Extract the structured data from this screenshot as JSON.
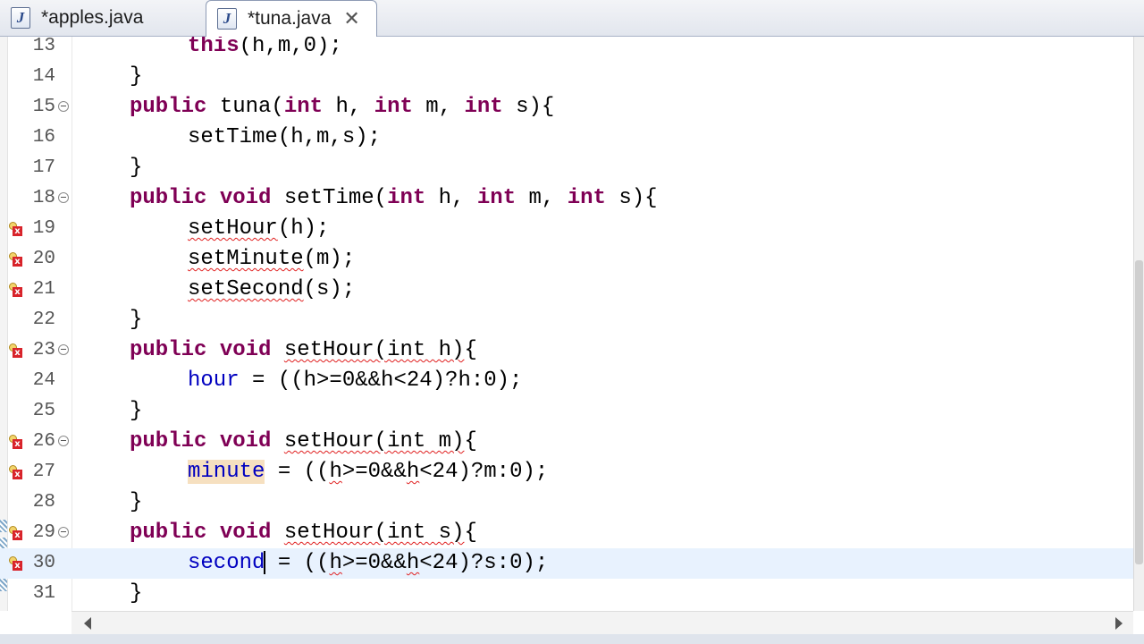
{
  "tabs": [
    {
      "label": "*apples.java",
      "icon": "java-file-icon",
      "active": false
    },
    {
      "label": "*tuna.java",
      "icon": "java-file-icon",
      "active": true
    }
  ],
  "editor": {
    "lines": [
      {
        "num": "13",
        "tokens": [
          {
            "t": "this",
            "c": "kw"
          },
          {
            "t": "(h,m,0);"
          }
        ],
        "indent": 2
      },
      {
        "num": "14",
        "tokens": [
          {
            "t": "}"
          }
        ],
        "indent": 1
      },
      {
        "num": "15",
        "fold": true,
        "tokens": [
          {
            "t": "public",
            "c": "kw"
          },
          {
            "t": " tuna("
          },
          {
            "t": "int",
            "c": "kw"
          },
          {
            "t": " h, "
          },
          {
            "t": "int",
            "c": "kw"
          },
          {
            "t": " m, "
          },
          {
            "t": "int",
            "c": "kw"
          },
          {
            "t": " s){"
          }
        ],
        "indent": 1
      },
      {
        "num": "16",
        "tokens": [
          {
            "t": "setTime(h,m,s);"
          }
        ],
        "indent": 2
      },
      {
        "num": "17",
        "tokens": [
          {
            "t": "}"
          }
        ],
        "indent": 1
      },
      {
        "num": "18",
        "fold": true,
        "tokens": [
          {
            "t": "public",
            "c": "kw"
          },
          {
            "t": " "
          },
          {
            "t": "void",
            "c": "kw"
          },
          {
            "t": " setTime("
          },
          {
            "t": "int",
            "c": "kw"
          },
          {
            "t": " h, "
          },
          {
            "t": "int",
            "c": "kw"
          },
          {
            "t": " m, "
          },
          {
            "t": "int",
            "c": "kw"
          },
          {
            "t": " s){"
          }
        ],
        "indent": 1
      },
      {
        "num": "19",
        "error": true,
        "tokens": [
          {
            "t": "setHour",
            "c": "sq"
          },
          {
            "t": "(h);"
          }
        ],
        "indent": 2
      },
      {
        "num": "20",
        "error": true,
        "tokens": [
          {
            "t": "setMinute",
            "c": "sq"
          },
          {
            "t": "(m);"
          }
        ],
        "indent": 2
      },
      {
        "num": "21",
        "error": true,
        "tokens": [
          {
            "t": "setSecond",
            "c": "sq"
          },
          {
            "t": "(s);"
          }
        ],
        "indent": 2
      },
      {
        "num": "22",
        "tokens": [
          {
            "t": "}"
          }
        ],
        "indent": 1
      },
      {
        "num": "23",
        "error": true,
        "fold": true,
        "tokens": [
          {
            "t": "public",
            "c": "kw"
          },
          {
            "t": " "
          },
          {
            "t": "void",
            "c": "kw"
          },
          {
            "t": " "
          },
          {
            "t": "setHour(int h)",
            "c": "sq"
          },
          {
            "t": "{"
          }
        ],
        "indent": 1
      },
      {
        "num": "24",
        "tokens": [
          {
            "t": "hour",
            "c": "fld"
          },
          {
            "t": " = ((h>=0&&h<24)?h:0);"
          }
        ],
        "indent": 2
      },
      {
        "num": "25",
        "tokens": [
          {
            "t": "}"
          }
        ],
        "indent": 1
      },
      {
        "num": "26",
        "error": true,
        "fold": true,
        "tokens": [
          {
            "t": "public",
            "c": "kw"
          },
          {
            "t": " "
          },
          {
            "t": "void",
            "c": "kw"
          },
          {
            "t": " "
          },
          {
            "t": "setHour(int m)",
            "c": "sq"
          },
          {
            "t": "{"
          }
        ],
        "indent": 1
      },
      {
        "num": "27",
        "error": true,
        "tokens": [
          {
            "t": "minute",
            "c": "fld occ"
          },
          {
            "t": " = (("
          },
          {
            "t": "h",
            "c": "sq"
          },
          {
            "t": ">=0&&"
          },
          {
            "t": "h",
            "c": "sq"
          },
          {
            "t": "<24)?m:0);"
          }
        ],
        "indent": 2
      },
      {
        "num": "28",
        "tokens": [
          {
            "t": "}"
          }
        ],
        "indent": 1
      },
      {
        "num": "29",
        "error": true,
        "fold": true,
        "tokens": [
          {
            "t": "public",
            "c": "kw"
          },
          {
            "t": " "
          },
          {
            "t": "void",
            "c": "kw"
          },
          {
            "t": " "
          },
          {
            "t": "setHour(int s)",
            "c": "sq"
          },
          {
            "t": "{"
          }
        ],
        "indent": 1
      },
      {
        "num": "30",
        "error": true,
        "current": true,
        "tokens": [
          {
            "t": "second",
            "c": "fld"
          },
          {
            "caret": true
          },
          {
            "t": " = (("
          },
          {
            "t": "h",
            "c": "sq"
          },
          {
            "t": ">=0&&"
          },
          {
            "t": "h",
            "c": "sq"
          },
          {
            "t": "<24)?s:0);"
          }
        ],
        "indent": 2
      },
      {
        "num": "31",
        "tokens": [
          {
            "t": "}"
          }
        ],
        "indent": 1
      }
    ]
  },
  "colors": {
    "keyword": "#7f0055",
    "field": "#0000c0",
    "error": "#d8232a",
    "current_line": "#e8f2fe"
  }
}
